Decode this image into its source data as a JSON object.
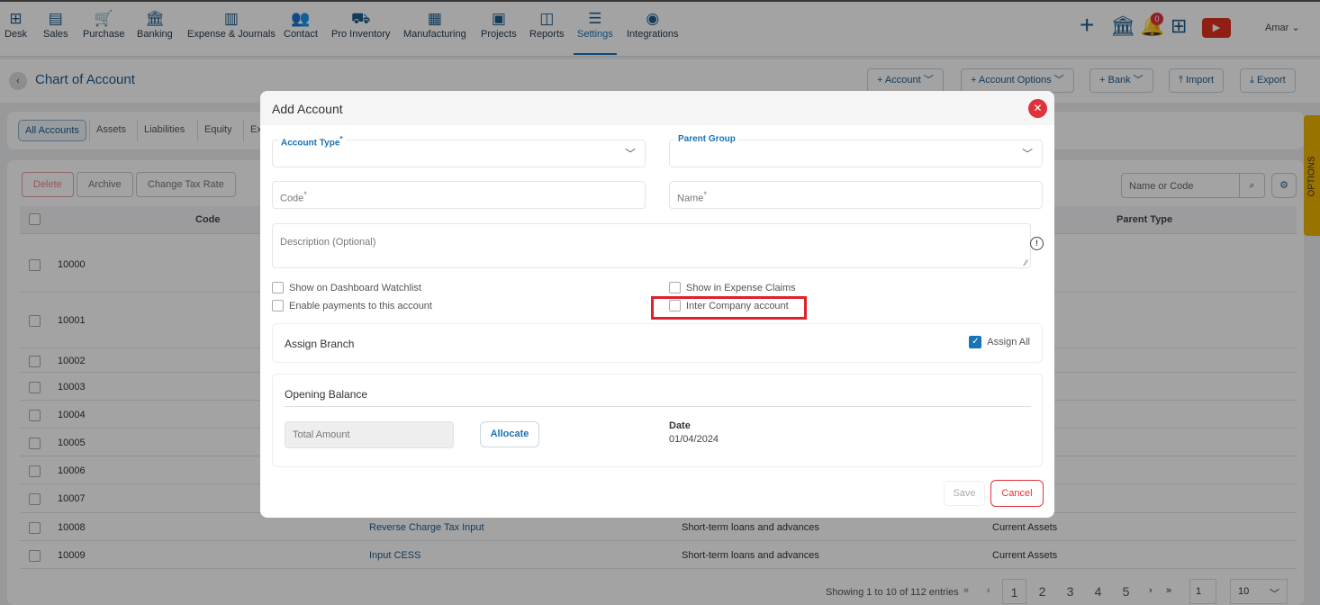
{
  "nav": {
    "items": [
      {
        "label": "Desk",
        "icon": "desk-icon",
        "glyph": "⊞"
      },
      {
        "label": "Sales",
        "icon": "sales-icon",
        "glyph": "▤"
      },
      {
        "label": "Purchase",
        "icon": "cart-icon",
        "glyph": "🛒"
      },
      {
        "label": "Banking",
        "icon": "bank-icon",
        "glyph": "🏛"
      },
      {
        "label": "Expense & Journals",
        "icon": "journal-icon",
        "glyph": "▥"
      },
      {
        "label": "Contact",
        "icon": "contact-icon",
        "glyph": "👥"
      },
      {
        "label": "Pro Inventory",
        "icon": "inventory-icon",
        "glyph": "⛟"
      },
      {
        "label": "Manufacturing",
        "icon": "factory-icon",
        "glyph": "▦"
      },
      {
        "label": "Projects",
        "icon": "projects-icon",
        "glyph": "▣"
      },
      {
        "label": "Reports",
        "icon": "reports-icon",
        "glyph": "◫"
      },
      {
        "label": "Settings",
        "icon": "sliders-icon",
        "glyph": "☰",
        "active": true
      },
      {
        "label": "Integrations",
        "icon": "integrations-icon",
        "glyph": "◉"
      }
    ],
    "notification_count": "0",
    "user": "Amar"
  },
  "header": {
    "title": "Chart of Account",
    "buttons": [
      "Account",
      "Account Options",
      "Bank",
      "Import",
      "Export"
    ]
  },
  "tabs": [
    "All Accounts",
    "Assets",
    "Liabilities",
    "Equity",
    "Ex"
  ],
  "actions": [
    "Delete",
    "Archive",
    "Change Tax Rate"
  ],
  "search": {
    "placeholder": "Name or Code"
  },
  "options_label": "OPTIONS",
  "table": {
    "columns": [
      "Code",
      "Parent Type"
    ],
    "rows": [
      {
        "code": "10000",
        "name": "",
        "group": "",
        "type": ""
      },
      {
        "code": "10001",
        "name": "",
        "group": "",
        "type": ""
      },
      {
        "code": "10002",
        "name": "",
        "group": "",
        "type": ""
      },
      {
        "code": "10003",
        "name": "",
        "group": "",
        "type": ""
      },
      {
        "code": "10004",
        "name": "",
        "group": "",
        "type": ""
      },
      {
        "code": "10005",
        "name": "",
        "group": "",
        "type": ""
      },
      {
        "code": "10006",
        "name": "",
        "group": "",
        "type": ""
      },
      {
        "code": "10007",
        "name": "",
        "group": "",
        "type": ""
      },
      {
        "code": "10008",
        "name": "Reverse Charge Tax Input",
        "group": "Short-term loans and advances",
        "type": "Current Assets"
      },
      {
        "code": "10009",
        "name": "Input CESS",
        "group": "Short-term loans and advances",
        "type": "Current Assets"
      }
    ]
  },
  "pagination": {
    "summary": "Showing 1 to 10 of 112 entries",
    "pages": [
      "1",
      "2",
      "3",
      "4",
      "5"
    ],
    "current": "1",
    "page_size": "10"
  },
  "modal": {
    "title": "Add Account",
    "account_type_label": "Account Type",
    "parent_group_label": "Parent Group",
    "code_placeholder": "Code",
    "name_placeholder": "Name",
    "description_placeholder": "Description (Optional)",
    "checkboxes": {
      "dashboard": "Show on Dashboard Watchlist",
      "payments": "Enable payments to this account",
      "expense": "Show in Expense Claims",
      "intercompany": "Inter Company account"
    },
    "assign_branch": "Assign Branch",
    "assign_all": "Assign All",
    "assign_all_checked": true,
    "opening_balance": "Opening Balance",
    "total_amount_placeholder": "Total Amount",
    "allocate": "Allocate",
    "date_label": "Date",
    "date_value": "01/04/2024",
    "save": "Save",
    "cancel": "Cancel"
  },
  "colors": {
    "accent": "#1a73b5",
    "danger": "#e0323c",
    "highlight": "#e0202a",
    "options_tab": "#f0b400"
  }
}
